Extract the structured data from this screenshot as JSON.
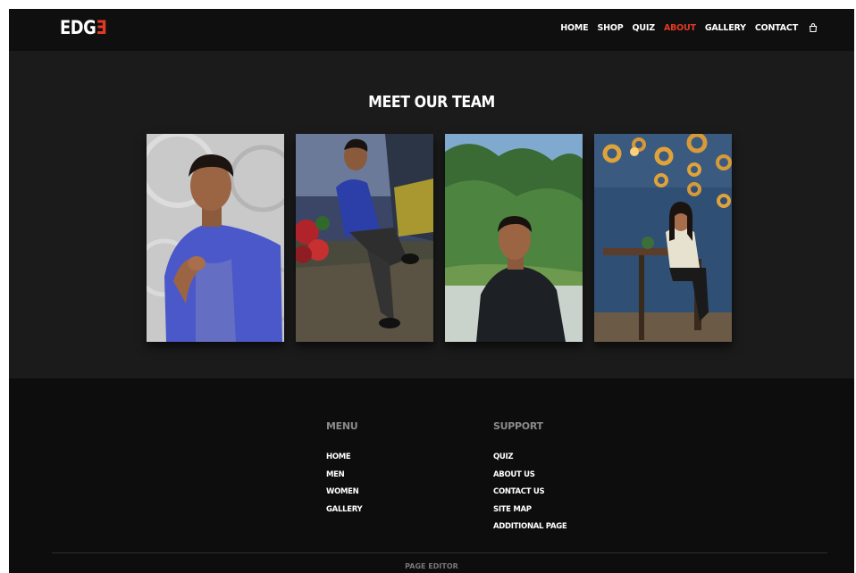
{
  "header": {
    "logo_main": "EDG",
    "logo_accent": "Ǝ",
    "nav": [
      {
        "label": "HOME"
      },
      {
        "label": "SHOP"
      },
      {
        "label": "QUIZ"
      },
      {
        "label": "ABOUT",
        "active": true
      },
      {
        "label": "GALLERY"
      },
      {
        "label": "CONTACT"
      }
    ],
    "cart_icon": "shopping-bag-icon"
  },
  "team": {
    "title": "MEET OUR TEAM",
    "photos": [
      "team-member-1",
      "team-member-2",
      "team-member-3",
      "team-member-4"
    ]
  },
  "footer": {
    "menu": {
      "heading": "MENU",
      "links": [
        "HOME",
        "MEN",
        "WOMEN",
        "GALLERY"
      ]
    },
    "support": {
      "heading": "SUPPORT",
      "links": [
        "QUIZ",
        "ABOUT US",
        "CONTACT US",
        "SITE MAP",
        "ADDITIONAL PAGE"
      ]
    },
    "credit": "PAGE EDITOR"
  },
  "colors": {
    "accent": "#e23a22",
    "header_bg": "#0f0f0f",
    "section_bg": "#1b1b1b",
    "footer_bg": "#0d0d0d"
  }
}
